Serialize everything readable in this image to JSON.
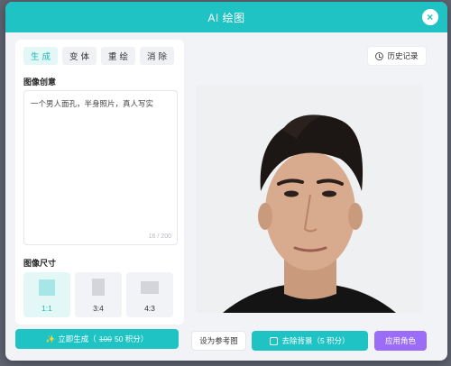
{
  "modal": {
    "title": "AI 绘图",
    "close_glyph": "×"
  },
  "tabs": [
    {
      "label": "生成",
      "active": true
    },
    {
      "label": "变体",
      "active": false
    },
    {
      "label": "重绘",
      "active": false
    },
    {
      "label": "消除",
      "active": false
    }
  ],
  "prompt": {
    "section_label": "图像创意",
    "value": "一个男人面孔，半身照片，真人写实",
    "count": "16 / 200"
  },
  "size": {
    "section_label": "图像尺寸",
    "options": [
      {
        "label": "1:1",
        "active": true
      },
      {
        "label": "3:4",
        "active": false
      },
      {
        "label": "4:3",
        "active": false
      }
    ]
  },
  "generate": {
    "label": "立即生成（",
    "original_cost": "100",
    "cost": "50 积分）",
    "icon": "sparkle-icon"
  },
  "history": {
    "label": "历史记录",
    "icon": "clock-icon"
  },
  "actions": {
    "set_reference": "设为参考图",
    "remove_bg": "去除背景（5 积分）",
    "apply_role": "应用角色"
  },
  "colors": {
    "accent": "#1fc3c3",
    "purple": "#9b6cf6"
  }
}
